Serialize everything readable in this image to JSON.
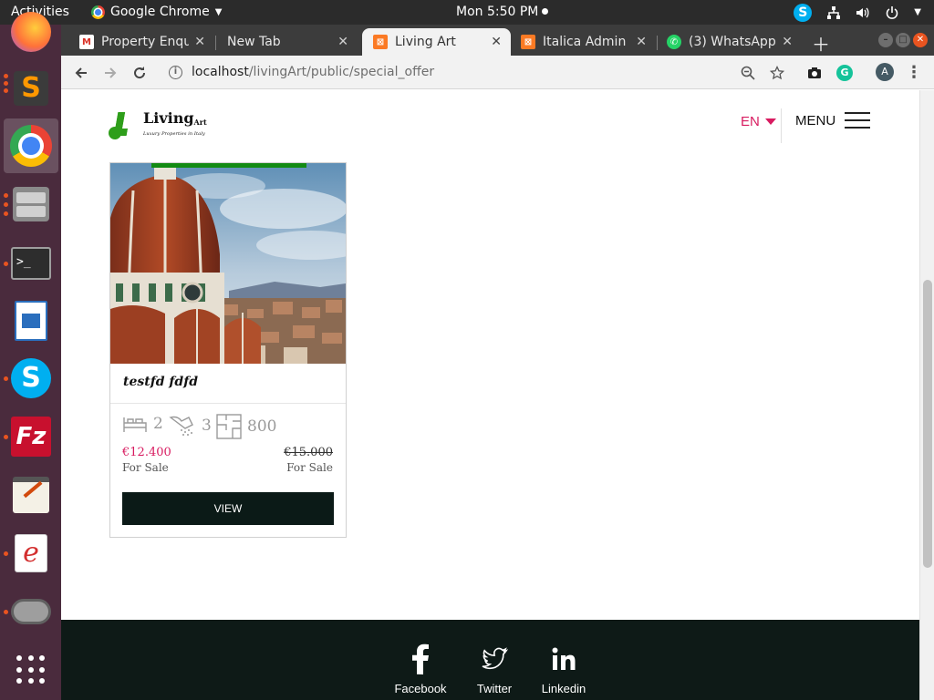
{
  "system_bar": {
    "activities": "Activities",
    "app_name": "Google Chrome",
    "clock": "Mon  5:50 PM"
  },
  "dock": {
    "apps": [
      "firefox",
      "sublime-text",
      "google-chrome",
      "files",
      "terminal",
      "libreoffice-writer",
      "skype",
      "filezilla",
      "text-editor",
      "document-viewer",
      "disk-tool",
      "show-applications"
    ]
  },
  "browser": {
    "tabs": [
      {
        "title": "Property Enqu",
        "favicon": "gmail-icon"
      },
      {
        "title": "New Tab",
        "favicon": ""
      },
      {
        "title": "Living Art",
        "favicon": "xampp-icon",
        "active": true
      },
      {
        "title": "Italica Admin",
        "favicon": "xampp-icon"
      },
      {
        "title": "(3) WhatsApp",
        "favicon": "whatsapp-icon"
      }
    ],
    "url_host": "localhost",
    "url_path": "/livingArt/public/special_offer",
    "profile_initial": "A",
    "grammarly_letter": "G"
  },
  "site": {
    "logo_name": "Living",
    "logo_sup": "Art",
    "logo_tagline": "Luxury Properties in Italy",
    "language": "EN",
    "menu_label": "MENU"
  },
  "listing": {
    "title": "testfd fdfd",
    "bedrooms": "2",
    "bathrooms": "3",
    "area": "800",
    "price": "€12.400",
    "old_price": "€15.000",
    "status_left": "For Sale",
    "status_right": "For Sale",
    "view_label": "VIEW"
  },
  "footer": {
    "social": [
      {
        "label": "Facebook",
        "icon": "facebook-icon"
      },
      {
        "label": "Twitter",
        "icon": "twitter-icon"
      },
      {
        "label": "Linkedin",
        "icon": "linkedin-icon"
      }
    ]
  },
  "colors": {
    "accent_price": "#d81b60",
    "brand_green": "#138a13",
    "footer_bg": "#0e1a17",
    "dock_bg": "#4a2b3d"
  }
}
